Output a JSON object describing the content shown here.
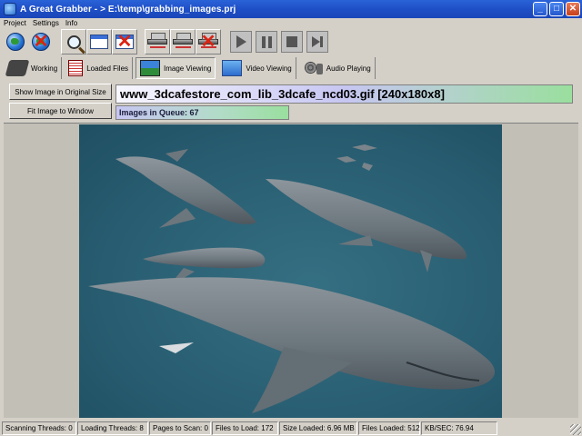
{
  "window": {
    "title": "A Great Grabber - > E:\\temp\\grabbing_images.prj",
    "minimize_label": "_",
    "maximize_label": "□",
    "close_label": "✕"
  },
  "menu": [
    "Project",
    "Settings",
    "Info"
  ],
  "toolbar": {
    "buttons": [
      "globe-connect-icon",
      "globe-disconnect-icon",
      "search-icon",
      "window-icon",
      "close-window-icon",
      "harvest-icon",
      "harvest-alt-icon",
      "harvest-stop-icon",
      "play-icon",
      "pause-icon",
      "stop-icon",
      "next-icon"
    ]
  },
  "tabs": [
    {
      "label": "Working",
      "icon": "chip-icon"
    },
    {
      "label": "Loaded Files",
      "icon": "document-icon"
    },
    {
      "label": "Image Viewing",
      "icon": "picture-icon",
      "active": true
    },
    {
      "label": "Video Viewing",
      "icon": "video-icon"
    },
    {
      "label": "Audio Playing",
      "icon": "audio-icon"
    }
  ],
  "controls": {
    "original_size_label": "Show Image in Original Size",
    "fit_window_label": "Fit Image to Window"
  },
  "file": {
    "name": "www_3dcafestore_com_lib_3dcafe_ncd03.gif  [240x180x8]",
    "queue": "Images in Queue: 67"
  },
  "status": {
    "scanning_threads": "Scanning Threads: 0",
    "loading_threads": "Loading Threads: 8",
    "pages_to_scan": "Pages to Scan: 0",
    "files_to_load": "Files to Load: 172",
    "size_loaded": "Size Loaded: 6.96 MB",
    "files_loaded": "Files Loaded: 512",
    "kb_sec": "KB/SEC: 76.94"
  },
  "colors": {
    "titlebar": "#1f4fc7",
    "window_bg": "#d4d0c8",
    "ocean": "#2a5f73"
  }
}
